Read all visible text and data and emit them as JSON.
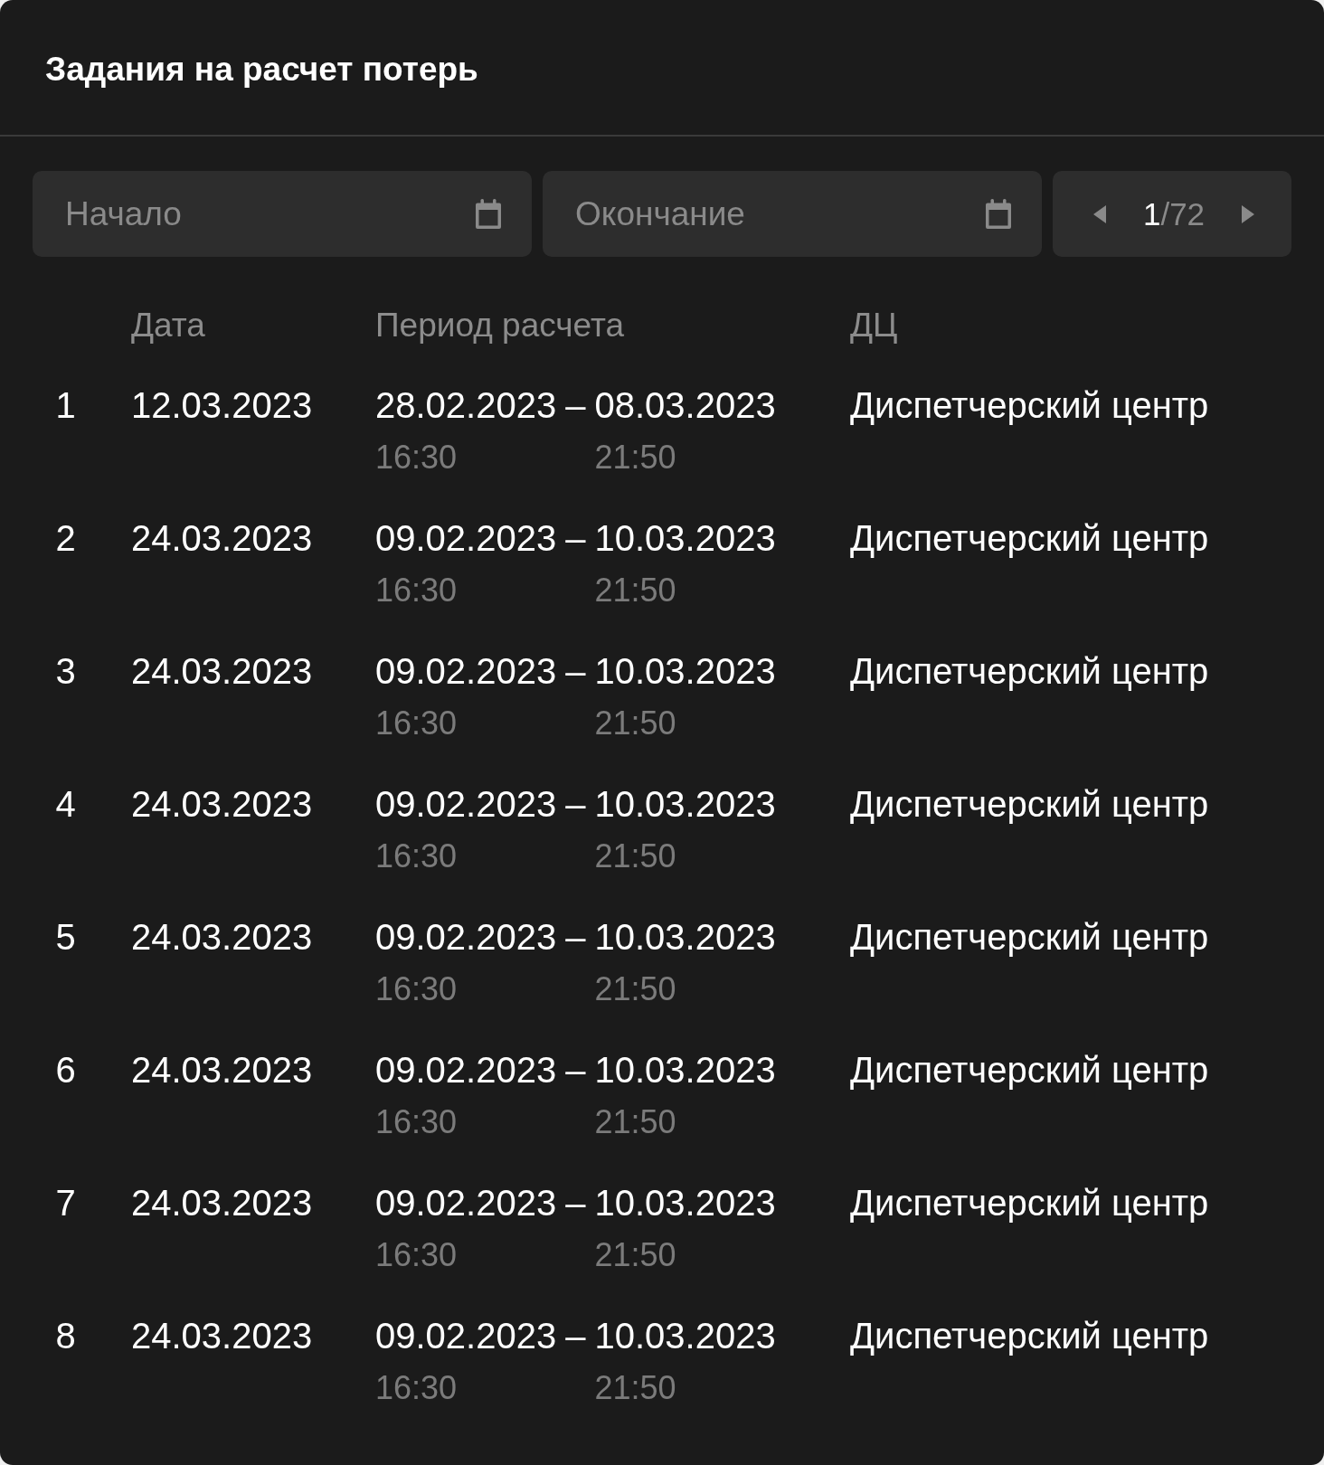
{
  "header": {
    "title": "Задания на расчет потерь"
  },
  "filters": {
    "start": {
      "placeholder": "Начало"
    },
    "end": {
      "placeholder": "Окончание"
    },
    "pager": {
      "current_page": "1",
      "of_pages": "/72"
    }
  },
  "table": {
    "columns": [
      "Дата",
      "Период расчета",
      "ДЦ"
    ],
    "rows": [
      {
        "number": "1",
        "date": "12.03.2023",
        "period_start": {
          "date": "28.02.2023",
          "time": "16:30"
        },
        "dash": "–",
        "period_end": {
          "date": "08.03.2023",
          "time": "21:50"
        },
        "center": "Диспетчерский центр"
      },
      {
        "number": "2",
        "date": "24.03.2023",
        "period_start": {
          "date": "09.02.2023",
          "time": "16:30"
        },
        "dash": "–",
        "period_end": {
          "date": "10.03.2023",
          "time": "21:50"
        },
        "center": "Диспетчерский центр"
      },
      {
        "number": "3",
        "date": "24.03.2023",
        "period_start": {
          "date": "09.02.2023",
          "time": "16:30"
        },
        "dash": "–",
        "period_end": {
          "date": "10.03.2023",
          "time": "21:50"
        },
        "center": "Диспетчерский центр"
      },
      {
        "number": "4",
        "date": "24.03.2023",
        "period_start": {
          "date": "09.02.2023",
          "time": "16:30"
        },
        "dash": "–",
        "period_end": {
          "date": "10.03.2023",
          "time": "21:50"
        },
        "center": "Диспетчерский центр"
      },
      {
        "number": "5",
        "date": "24.03.2023",
        "period_start": {
          "date": "09.02.2023",
          "time": "16:30"
        },
        "dash": "–",
        "period_end": {
          "date": "10.03.2023",
          "time": "21:50"
        },
        "center": "Диспетчерский центр"
      },
      {
        "number": "6",
        "date": "24.03.2023",
        "period_start": {
          "date": "09.02.2023",
          "time": "16:30"
        },
        "dash": "–",
        "period_end": {
          "date": "10.03.2023",
          "time": "21:50"
        },
        "center": "Диспетчерский центр"
      },
      {
        "number": "7",
        "date": "24.03.2023",
        "period_start": {
          "date": "09.02.2023",
          "time": "16:30"
        },
        "dash": "–",
        "period_end": {
          "date": "10.03.2023",
          "time": "21:50"
        },
        "center": "Диспетчерский центр"
      },
      {
        "number": "8",
        "date": "24.03.2023",
        "period_start": {
          "date": "09.02.2023",
          "time": "16:30"
        },
        "dash": "–",
        "period_end": {
          "date": "10.03.2023",
          "time": "21:50"
        },
        "center": "Диспетчерский центр"
      }
    ]
  }
}
